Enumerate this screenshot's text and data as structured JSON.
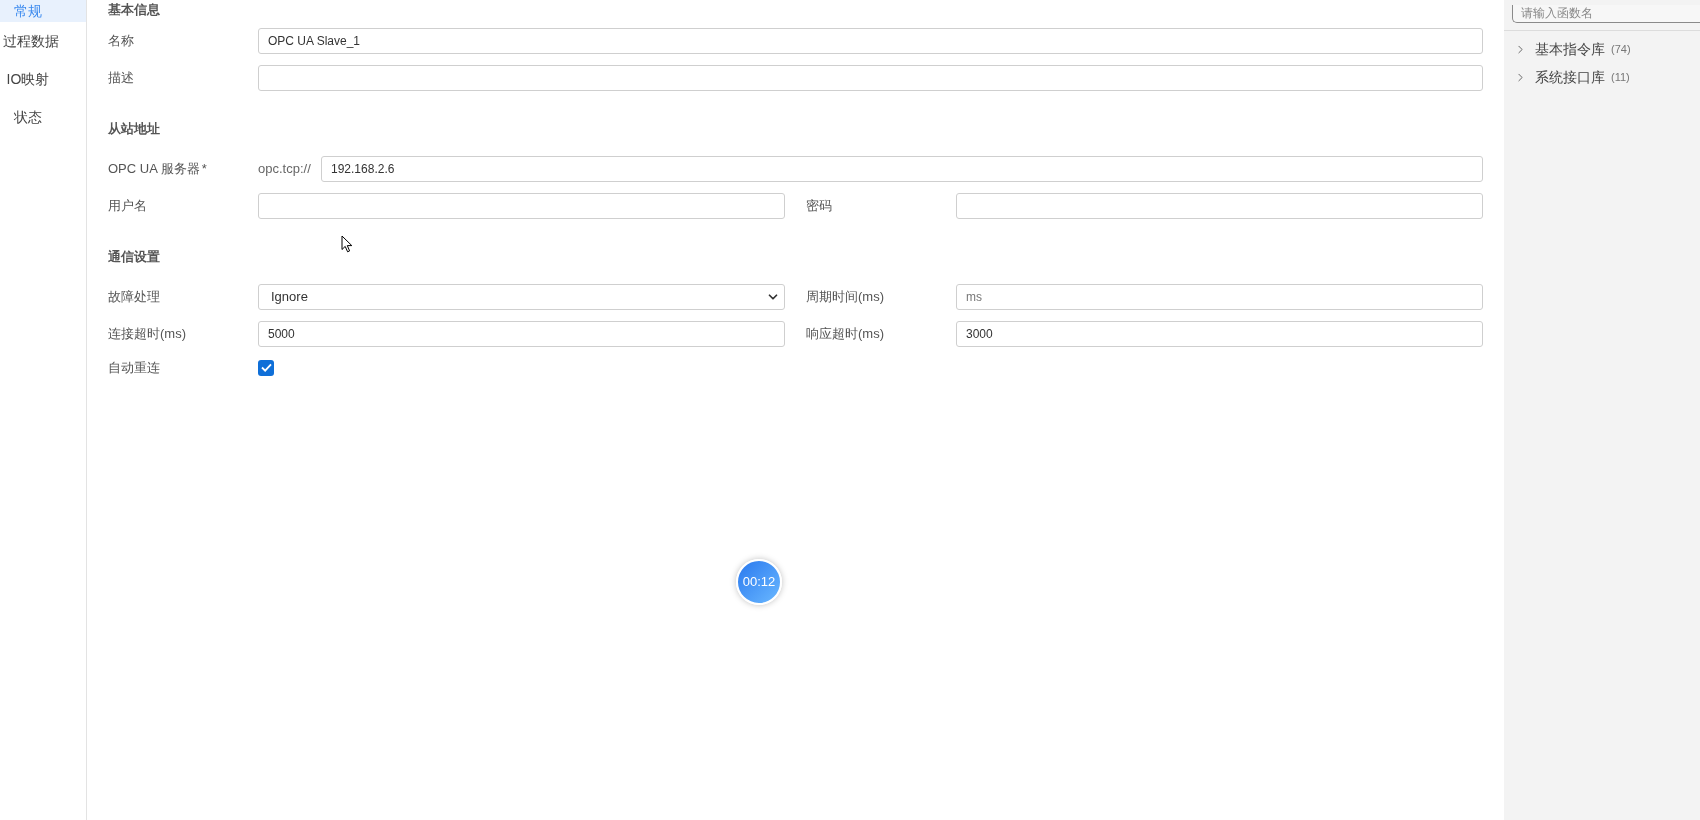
{
  "sidebar": {
    "items": [
      {
        "label": "常规",
        "selected": true
      },
      {
        "label": "过程数据",
        "selected": false
      },
      {
        "label": "IO映射",
        "selected": false
      },
      {
        "label": "状态",
        "selected": false
      }
    ]
  },
  "form": {
    "sections": [
      {
        "title": "基本信息",
        "rows": [
          {
            "fields": [
              {
                "kind": "text",
                "label": "名称",
                "value": "OPC UA Slave_1"
              }
            ]
          },
          {
            "fields": [
              {
                "kind": "text",
                "label": "描述"
              }
            ]
          }
        ]
      },
      {
        "title": "从站地址",
        "rows": [
          {
            "fields": [
              {
                "kind": "prefixed",
                "label": "OPC UA 服务器",
                "required_mark": "*",
                "prefix": "opc.tcp://",
                "value": "192.168.2.6"
              }
            ]
          },
          {
            "fields": [
              {
                "kind": "text",
                "label": "用户名"
              },
              {
                "kind": "text",
                "label": "密码"
              }
            ]
          }
        ]
      },
      {
        "title": "通信设置",
        "rows": [
          {
            "fields": [
              {
                "kind": "select",
                "label": "故障处理",
                "value": "Ignore"
              },
              {
                "kind": "text",
                "label": "周期时间(ms)",
                "placeholder": "ms"
              }
            ]
          },
          {
            "fields": [
              {
                "kind": "text",
                "label": "连接超时(ms)",
                "value": "5000"
              },
              {
                "kind": "text",
                "label": "响应超时(ms)",
                "value": "3000"
              }
            ]
          },
          {
            "fields": [
              {
                "kind": "checkbox",
                "label": "自动重连",
                "checked": true
              }
            ]
          }
        ]
      }
    ]
  },
  "library_panel": {
    "search": {
      "placeholder": "请输入函数名"
    },
    "tree": [
      {
        "label": "基本指令库",
        "count": "(74)",
        "expanded": false
      },
      {
        "label": "系统接口库",
        "count": "(11)",
        "expanded": false
      }
    ]
  },
  "timer": {
    "text": "00:12"
  }
}
